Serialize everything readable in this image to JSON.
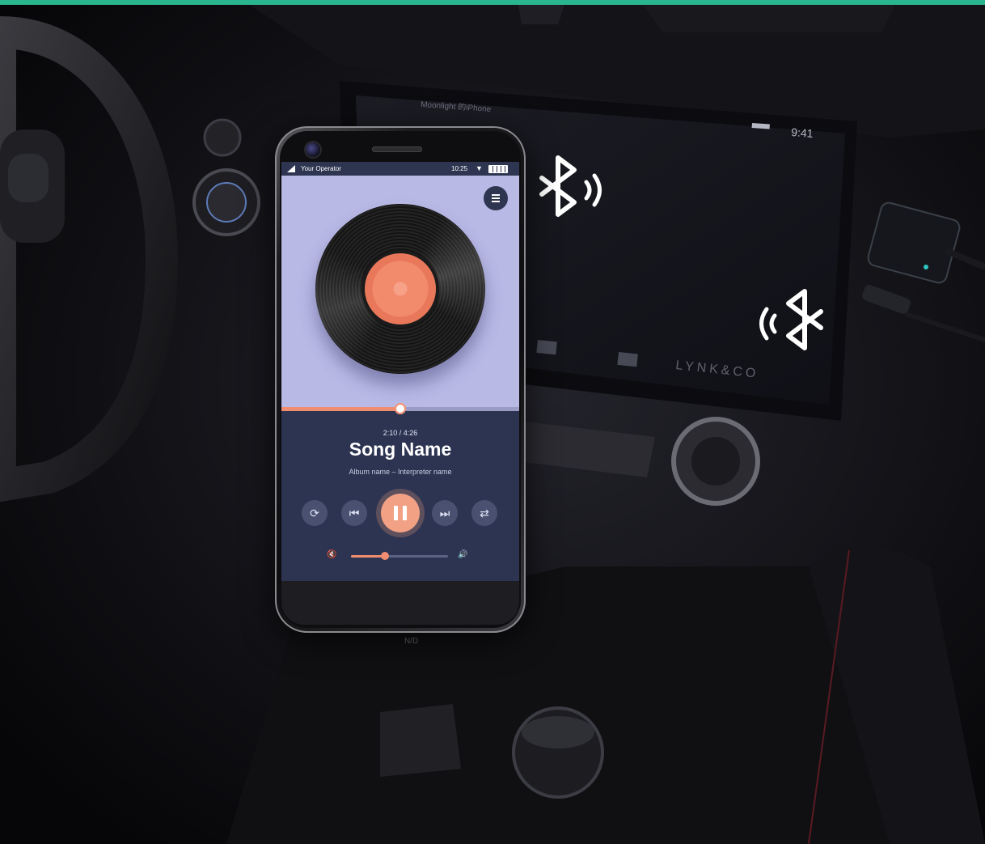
{
  "car_screen": {
    "now_playing_label": "Moonlight 的iPhone",
    "status_time": "9:41",
    "brand_logo": "LYNK&CO"
  },
  "phone": {
    "status_bar": {
      "operator": "Your Operator",
      "time": "10:25"
    },
    "player": {
      "time_label": "2:10 / 4:26",
      "song_name": "Song Name",
      "album_label": "Album name – Interpreter name",
      "progress": 0.5,
      "volume": 0.35,
      "controls": [
        "repeat-icon",
        "previous-icon",
        "pause-icon",
        "next-icon",
        "shuffle-icon"
      ]
    }
  },
  "gear_label": "N/D",
  "colors": {
    "accent": "#f08d70",
    "player_panel": "#2d3451",
    "player_background": "#b9b9e6",
    "top_bar": "#2ab58f"
  },
  "icons": [
    "bluetooth-icon",
    "bluetooth-icon"
  ]
}
